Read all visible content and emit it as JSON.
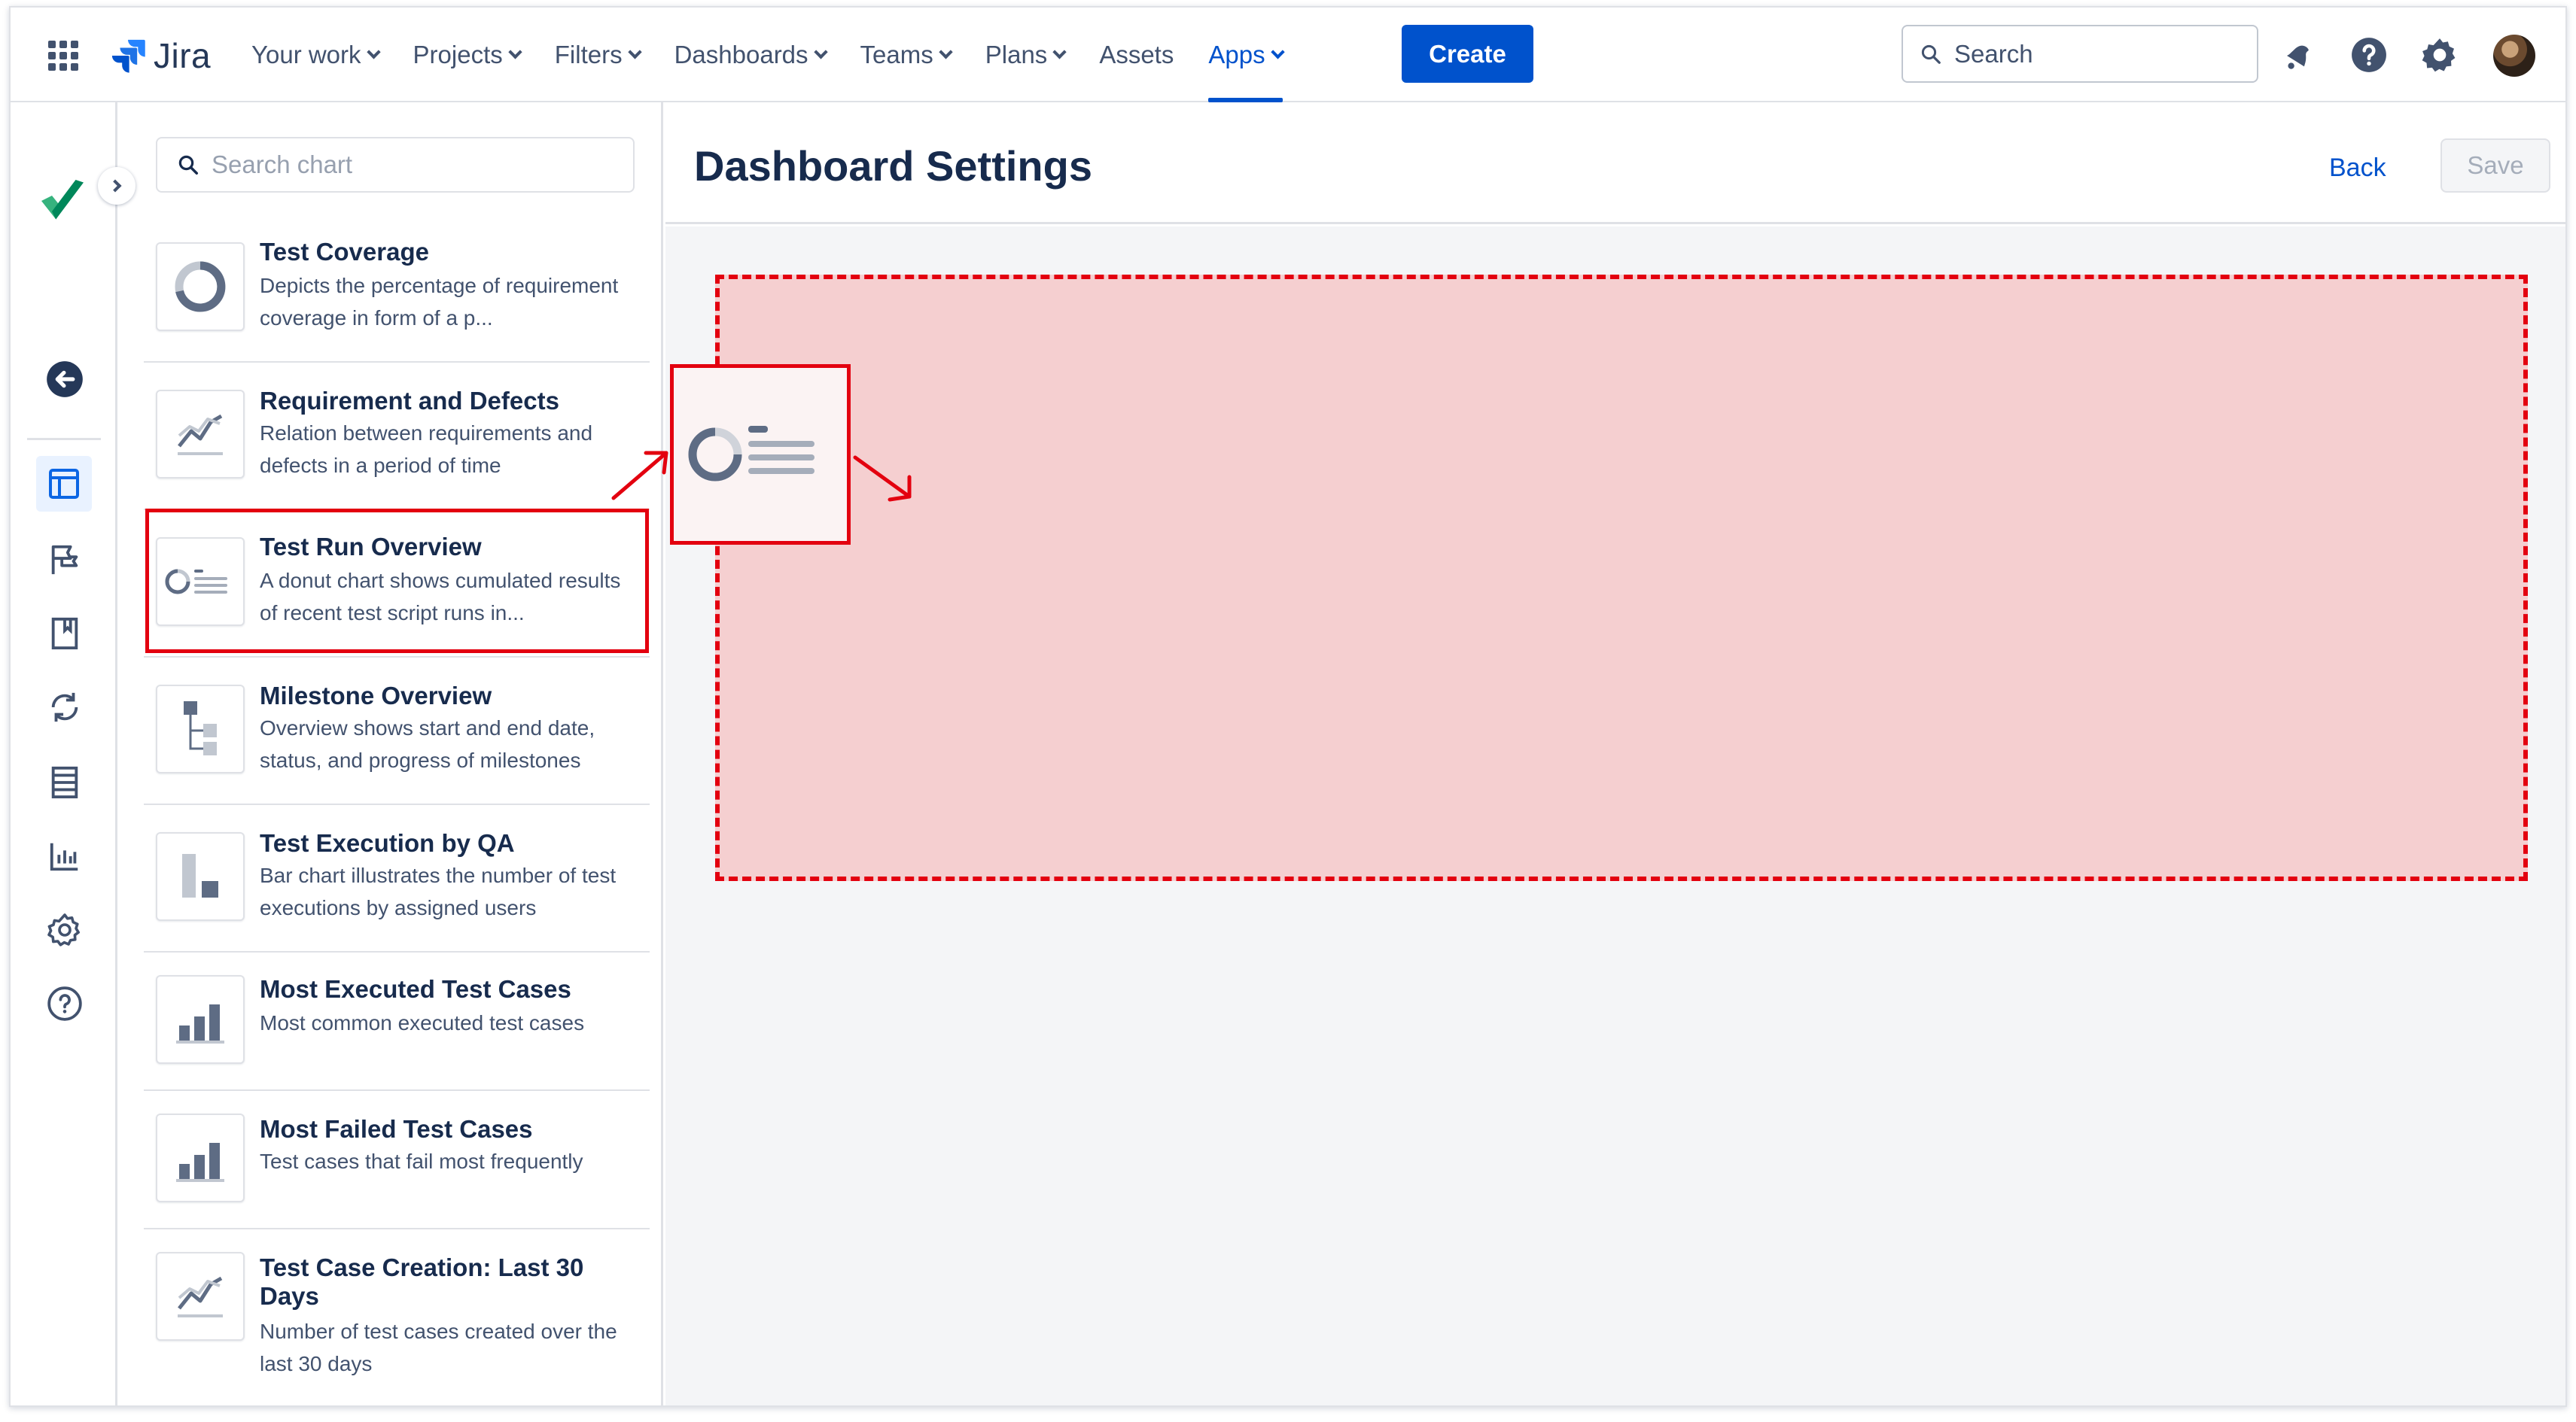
{
  "app": {
    "name": "Jira",
    "nav": [
      {
        "label": "Your work",
        "dropdown": true,
        "active": false
      },
      {
        "label": "Projects",
        "dropdown": true,
        "active": false
      },
      {
        "label": "Filters",
        "dropdown": true,
        "active": false
      },
      {
        "label": "Dashboards",
        "dropdown": true,
        "active": false
      },
      {
        "label": "Teams",
        "dropdown": true,
        "active": false
      },
      {
        "label": "Plans",
        "dropdown": true,
        "active": false
      },
      {
        "label": "Assets",
        "dropdown": false,
        "active": false
      },
      {
        "label": "Apps",
        "dropdown": true,
        "active": true
      }
    ],
    "create_label": "Create",
    "search_placeholder": "Search",
    "icons": [
      "notifications-icon",
      "help-icon",
      "settings-icon",
      "avatar"
    ]
  },
  "rail": {
    "icons": [
      "back-arrow-icon",
      "dashboard-icon",
      "milestone-flag-icon",
      "book-icon",
      "cycle-icon",
      "table-icon",
      "report-chart-icon",
      "settings-icon",
      "help-icon"
    ]
  },
  "panel": {
    "search_placeholder": "Search chart",
    "charts": [
      {
        "title": "Test Coverage",
        "desc": "Depicts the percentage of requirement coverage in form of a p...",
        "thumb": "donut"
      },
      {
        "title": "Requirement and Defects",
        "desc": "Relation between requirements and defects in a period of time",
        "thumb": "line"
      },
      {
        "title": "Test Run Overview",
        "desc": "A donut chart shows cumulated results of recent test script runs in...",
        "thumb": "donut-list",
        "selected": true
      },
      {
        "title": "Milestone Overview",
        "desc": "Overview shows start and end date, status, and progress of milestones",
        "thumb": "tree"
      },
      {
        "title": "Test Execution by QA",
        "desc": "Bar chart illustrates the number of test executions by assigned users",
        "thumb": "bar-two"
      },
      {
        "title": "Most Executed Test Cases",
        "desc": "Most common executed test cases",
        "thumb": "bars"
      },
      {
        "title": "Most Failed Test Cases",
        "desc": "Test cases that fail most frequently",
        "thumb": "bars"
      },
      {
        "title": "Test Case Creation: Last 30 Days",
        "desc": "Number of test cases created over the last 30 days",
        "thumb": "line"
      }
    ]
  },
  "main": {
    "title": "Dashboard Settings",
    "back_label": "Back",
    "save_label": "Save"
  },
  "colors": {
    "brand": "#0052cc",
    "highlight": "#e3000f",
    "dropzone": "#f5cfd0"
  }
}
